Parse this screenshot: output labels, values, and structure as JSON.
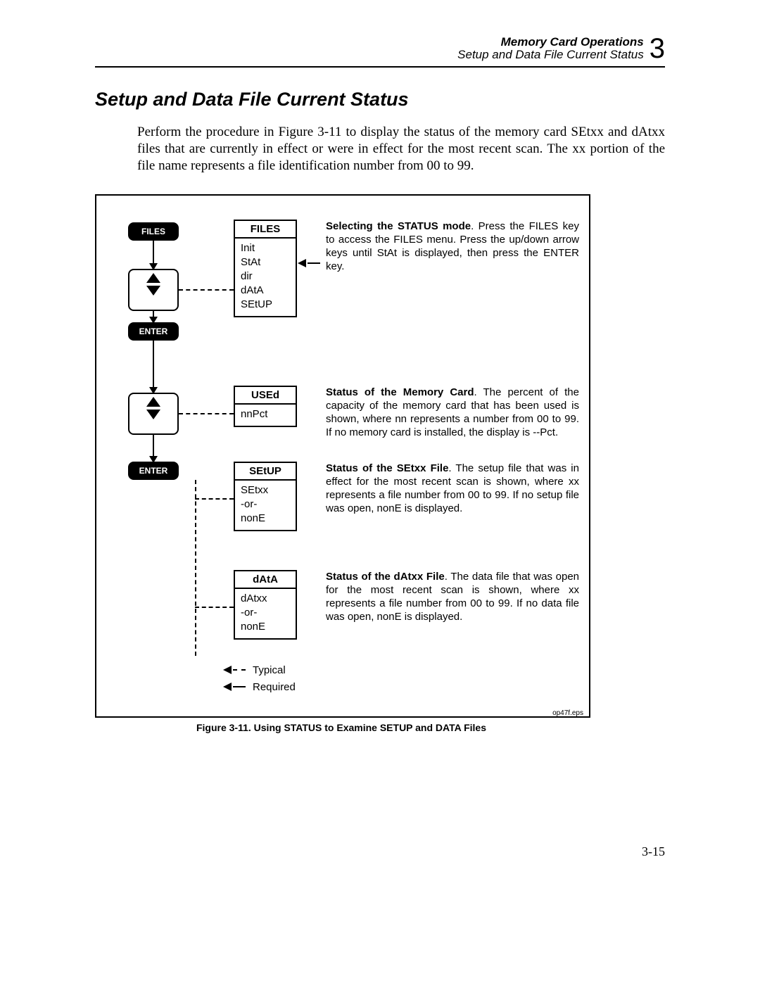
{
  "header": {
    "line1": "Memory Card Operations",
    "line2": "Setup and Data File Current Status",
    "chapter_num": "3"
  },
  "section_title": "Setup and Data File Current Status",
  "intro": "Perform the procedure in Figure 3-11 to display the status of the memory card SEtxx and dAtxx files that are currently in effect or were in effect for the most recent scan. The xx portion of the file name represents a file identification number from 00 to 99.",
  "keys": {
    "files": "FILES",
    "enter": "ENTER"
  },
  "menus": {
    "files": {
      "title": "FILES",
      "items": [
        "Init",
        "StAt",
        "dir",
        "dAtA",
        "SEtUP"
      ]
    },
    "used": {
      "title": "USEd",
      "items": [
        "nnPct"
      ]
    },
    "setup": {
      "title": "SEtUP",
      "items": [
        "SEtxx",
        "-or-",
        "nonE"
      ]
    },
    "data": {
      "title": "dAtA",
      "items": [
        "dAtxx",
        "-or-",
        "nonE"
      ]
    }
  },
  "descriptions": {
    "d1_bold": "Selecting the STATUS mode",
    "d1_rest": ".  Press the FILES key to access the FILES menu.  Press the up/down arrow keys until StAt is displayed, then press the ENTER key.",
    "d2_bold": "Status of the Memory Card",
    "d2_rest": ".  The percent of the capacity of the memory card that has been used is shown, where nn represents a number from 00 to 99.  If no memory card is installed, the display is --Pct.",
    "d3_bold": "Status of the SEtxx File",
    "d3_rest": ".  The setup file that was in effect for the most recent scan is shown, where xx represents a file number from 00 to 99.  If no setup file was open, nonE is displayed.",
    "d4_bold": "Status of the dAtxx File",
    "d4_rest": ".  The data file that was open for the most recent scan is shown, where xx represents a file number from 00 to 99.  If no data file was open, nonE is displayed."
  },
  "legend": {
    "typical": "Typical",
    "required": "Required"
  },
  "figure": {
    "eps": "op47f.eps",
    "caption": "Figure 3-11. Using STATUS to Examine SETUP and DATA Files"
  },
  "page_number": "3-15"
}
